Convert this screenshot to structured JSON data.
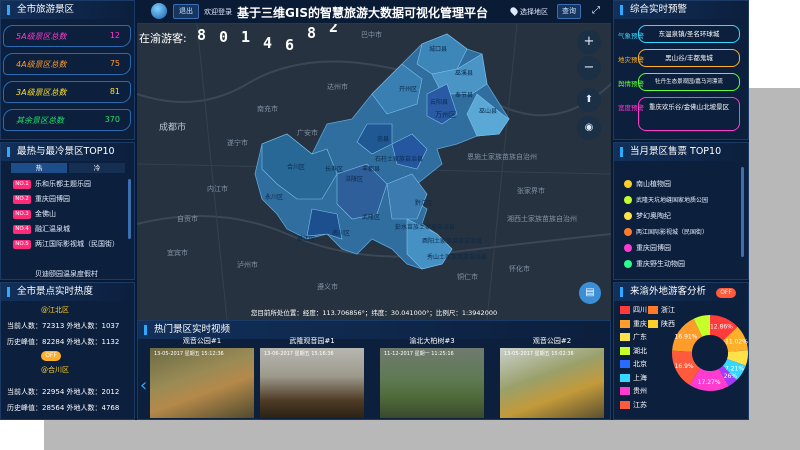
{
  "header": {
    "title": "基于三维GIS的智慧旅游大数据可视化管理平台",
    "logout": "退出",
    "welcome": "欢迎登录",
    "region_select": "选择地区",
    "query": "查询"
  },
  "scenic_total": {
    "title": "全市旅游景区",
    "rows": [
      {
        "label": "5A级景区总数",
        "value": "12",
        "color": "#ff3bd0"
      },
      {
        "label": "4A级景区总数",
        "value": "75",
        "color": "#ff9c2a"
      },
      {
        "label": "3A级景区总数",
        "value": "81",
        "color": "#ffe12a"
      },
      {
        "label": "其余景区总数",
        "value": "370",
        "color": "#25e06a"
      }
    ]
  },
  "hot_cold": {
    "title": "最热与最冷景区TOP10",
    "tab_hot": "热",
    "tab_cold": "冷",
    "items": [
      {
        "badge": "NO.1",
        "name": "乐和乐都主题乐园"
      },
      {
        "badge": "NO.2",
        "name": "重庆园博园"
      },
      {
        "badge": "NO.3",
        "name": "金佛山"
      },
      {
        "badge": "NO.4",
        "name": "融汇温泉城"
      },
      {
        "badge": "NO.5",
        "name": "两江国际影视城（民国街）"
      },
      {
        "badge": "",
        "name": "贝迪颐园温泉度假村"
      }
    ]
  },
  "heat": {
    "title": "全市景点实时热度",
    "sections": [
      {
        "district": "@江北区",
        "current_label": "当前人数：",
        "current": "72313",
        "current_tag": "外地人数：",
        "current_outside": "1037",
        "history_label": "历史峰值：",
        "history": "82284",
        "history_tag": "外地人数：",
        "history_outside": "1132",
        "toggle": "OFF"
      },
      {
        "district": "@合川区",
        "current_label": "当前人数：",
        "current": "22954",
        "current_tag": "外地人数：",
        "current_outside": "2012",
        "history_label": "历史峰值：",
        "history": "28564",
        "history_tag": "外地人数：",
        "history_outside": "4768"
      }
    ]
  },
  "map": {
    "counter_label": "在渝游客:",
    "counter_digits": [
      "8",
      "0",
      "1",
      "4",
      "6",
      "8",
      "2"
    ],
    "zoom_in": "+",
    "zoom_out": "−",
    "coord_text": "您目前所处位置：经度：113.706856°；纬度：30.041000°；比例尺：1:3942000",
    "labels": [
      "成都市",
      "南充市",
      "达州市",
      "万州区",
      "广安市",
      "遂宁市",
      "内江市",
      "自贡市",
      "泸州市",
      "遵义市",
      "铜仁市",
      "怀化市",
      "恩施土家族苗族自治州",
      "湘西土家族苗族自治州",
      "张家界市",
      "宜宾市",
      "巴中市"
    ],
    "district_labels": [
      "城口县",
      "开州区",
      "巫溪县",
      "巫山县",
      "云阳县",
      "奉节县",
      "忠县",
      "丰都县",
      "石柱土家族自治县",
      "武隆区",
      "涪陵区",
      "长寿区",
      "合川区",
      "永川区",
      "綦江区",
      "南川区",
      "彭水苗族土家族自治县",
      "黔江区",
      "酉阳土家族苗族自治县",
      "秀山土家族苗族自治县"
    ]
  },
  "warning": {
    "title": "综合实时预警",
    "rows": [
      {
        "label": "气象预警",
        "text": "东温泉镇/圣名环球城",
        "color": "#35d8ff"
      },
      {
        "label": "地灾预警",
        "text": "黑山谷/丰都鬼城",
        "color": "#ffb02a"
      },
      {
        "label": "舆情预警",
        "text": "牡丹生态景观园/嘉马河漂流",
        "color": "#5dff3a"
      },
      {
        "label": "宽度预警",
        "text": "重庆欢乐谷/金佛山北坡景区",
        "color": "#ff3bd0"
      }
    ]
  },
  "tickets": {
    "title": "当月景区售票 TOP10",
    "items": [
      {
        "name": "南山植物园",
        "color": "#ffcf2a"
      },
      {
        "name": "武隆天坑地缝国家地质公园",
        "color": "#c6ff2a"
      },
      {
        "name": "梦幻奥陶纪",
        "color": "#ffe24a"
      },
      {
        "name": "两江国际影视城（民国街）",
        "color": "#ff7a2a"
      },
      {
        "name": "重庆园博园",
        "color": "#ff3bd0"
      },
      {
        "name": "重庆野生动物园",
        "color": "#2aff8c"
      },
      {
        "name": "重庆海洋公园",
        "color": "#35d8ff"
      },
      {
        "name": "重庆乐园",
        "color": "#ff3b3b"
      }
    ]
  },
  "videos": {
    "title": "热门景区实时视频",
    "items": [
      {
        "name": "观音公园#1",
        "ts": "13-05-2017 星期五 15:12:36"
      },
      {
        "name": "武隆观音园#1",
        "ts": "13-06-2017 星期五 15:16:36"
      },
      {
        "name": "渝北大柏树#3",
        "ts": "11-12-2017 星期一 11:25:16"
      },
      {
        "name": "观音公园#2",
        "ts": "13-05-2017 星期五 15:02:36"
      }
    ]
  },
  "origin": {
    "title": "来渝外地游客分析",
    "toggle": "OFF",
    "legend": [
      {
        "name": "四川",
        "color": "#ff3b3b"
      },
      {
        "name": "浙江",
        "color": "#ff7a2a"
      },
      {
        "name": "重庆",
        "color": "#ff9c2a"
      },
      {
        "name": "陕西",
        "color": "#ffcf2a"
      },
      {
        "name": "广东",
        "color": "#ffe24a"
      },
      {
        "name": "湖北",
        "color": "#c6ff2a"
      },
      {
        "name": "北京",
        "color": "#2a6bff"
      },
      {
        "name": "上海",
        "color": "#35d8ff"
      },
      {
        "name": "贵州",
        "color": "#ff3bd0"
      },
      {
        "name": "江苏",
        "color": "#ff5a3b"
      }
    ],
    "pie": [
      {
        "pct": "12.86%",
        "value": 12.86,
        "color": "#ff3b3b"
      },
      {
        "pct": "11.02%",
        "value": 11.02,
        "color": "#ffb02a"
      },
      {
        "pct": "",
        "value": 6.5,
        "color": "#ffe24a"
      },
      {
        "pct": "7.21%",
        "value": 7.21,
        "color": "#35d8ff"
      },
      {
        "pct": "4.26%",
        "value": 4.26,
        "color": "#a33bff"
      },
      {
        "pct": "17.27%",
        "value": 17.27,
        "color": "#ff3bd0"
      },
      {
        "pct": "16.9%",
        "value": 16.9,
        "color": "#ff5a3b"
      },
      {
        "pct": "16.91%",
        "value": 16.91,
        "color": "#ff9c2a"
      },
      {
        "pct": "",
        "value": 7.07,
        "color": "#c6ff2a"
      }
    ]
  }
}
